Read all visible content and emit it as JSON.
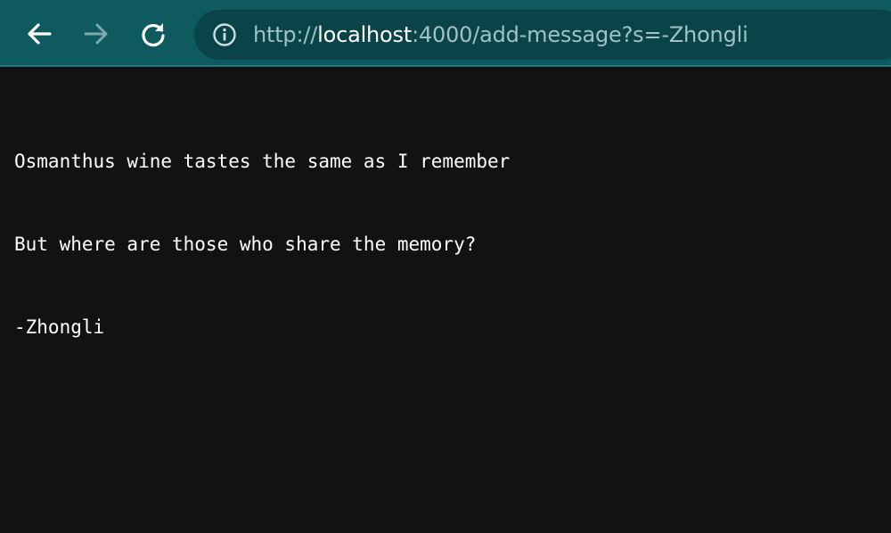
{
  "toolbar": {
    "back_icon": "arrow-left-icon",
    "forward_icon": "arrow-right-icon",
    "reload_icon": "reload-icon",
    "colors": {
      "toolbar_bg": "#0f5a5e",
      "omnibox_bg": "#0b4448",
      "icon_active": "#ffffff",
      "icon_disabled": "#7fa9ac",
      "url_dim": "#9fc3c5"
    }
  },
  "address_bar": {
    "info_icon": "info-icon",
    "scheme": "http://",
    "host": "localhost",
    "rest": ":4000/add-message?s=-Zhongli"
  },
  "page": {
    "background": "#121212",
    "text_color": "#ffffff",
    "lines": [
      "Osmanthus wine tastes the same as I remember",
      "But where are those who share the memory?",
      "-Zhongli"
    ]
  }
}
